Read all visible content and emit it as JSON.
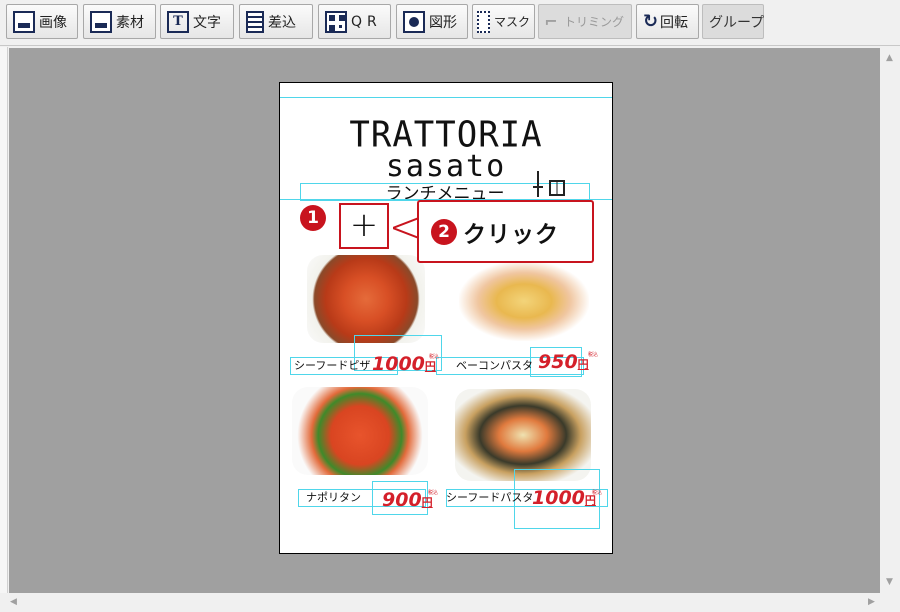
{
  "toolbar": {
    "buttons": [
      {
        "label": "画像",
        "icon": "image-icon"
      },
      {
        "label": "素材",
        "icon": "material-icon"
      },
      {
        "label": "文字",
        "icon": "text-icon"
      },
      {
        "label": "差込",
        "icon": "merge-icon"
      },
      {
        "label": "QR",
        "icon": "qr-icon"
      },
      {
        "label": "図形",
        "icon": "shape-icon"
      },
      {
        "label": "マスク",
        "icon": "mask-icon"
      },
      {
        "label": "トリミング",
        "icon": "crop-icon",
        "disabled": true
      },
      {
        "label": "回転",
        "icon": "rotate-icon"
      },
      {
        "label": "グループ",
        "disabled": true
      }
    ]
  },
  "page": {
    "title_line1": "TRATTORIA",
    "title_line2": "sasato",
    "subtitle": "ランチメニュー",
    "menu": [
      {
        "name": "シーフードピザ",
        "price": "1000",
        "yen": "円",
        "tax": "税込"
      },
      {
        "name": "ベーコンパスタ",
        "price": "950",
        "yen": "円",
        "tax": "税込"
      },
      {
        "name": "ナポリタン",
        "price": "900",
        "yen": "円",
        "tax": "税込"
      },
      {
        "name": "シーフードパスタ",
        "price": "1000",
        "yen": "円",
        "tax": "税込"
      }
    ]
  },
  "annotation": {
    "step1": "1",
    "step2": "2",
    "plus": "+",
    "callout": "クリック"
  },
  "colors": {
    "accent_red": "#c8141e",
    "price_red": "#d4202a",
    "guide_cyan": "#4fd6ea",
    "canvas_gray": "#a0a0a0"
  }
}
